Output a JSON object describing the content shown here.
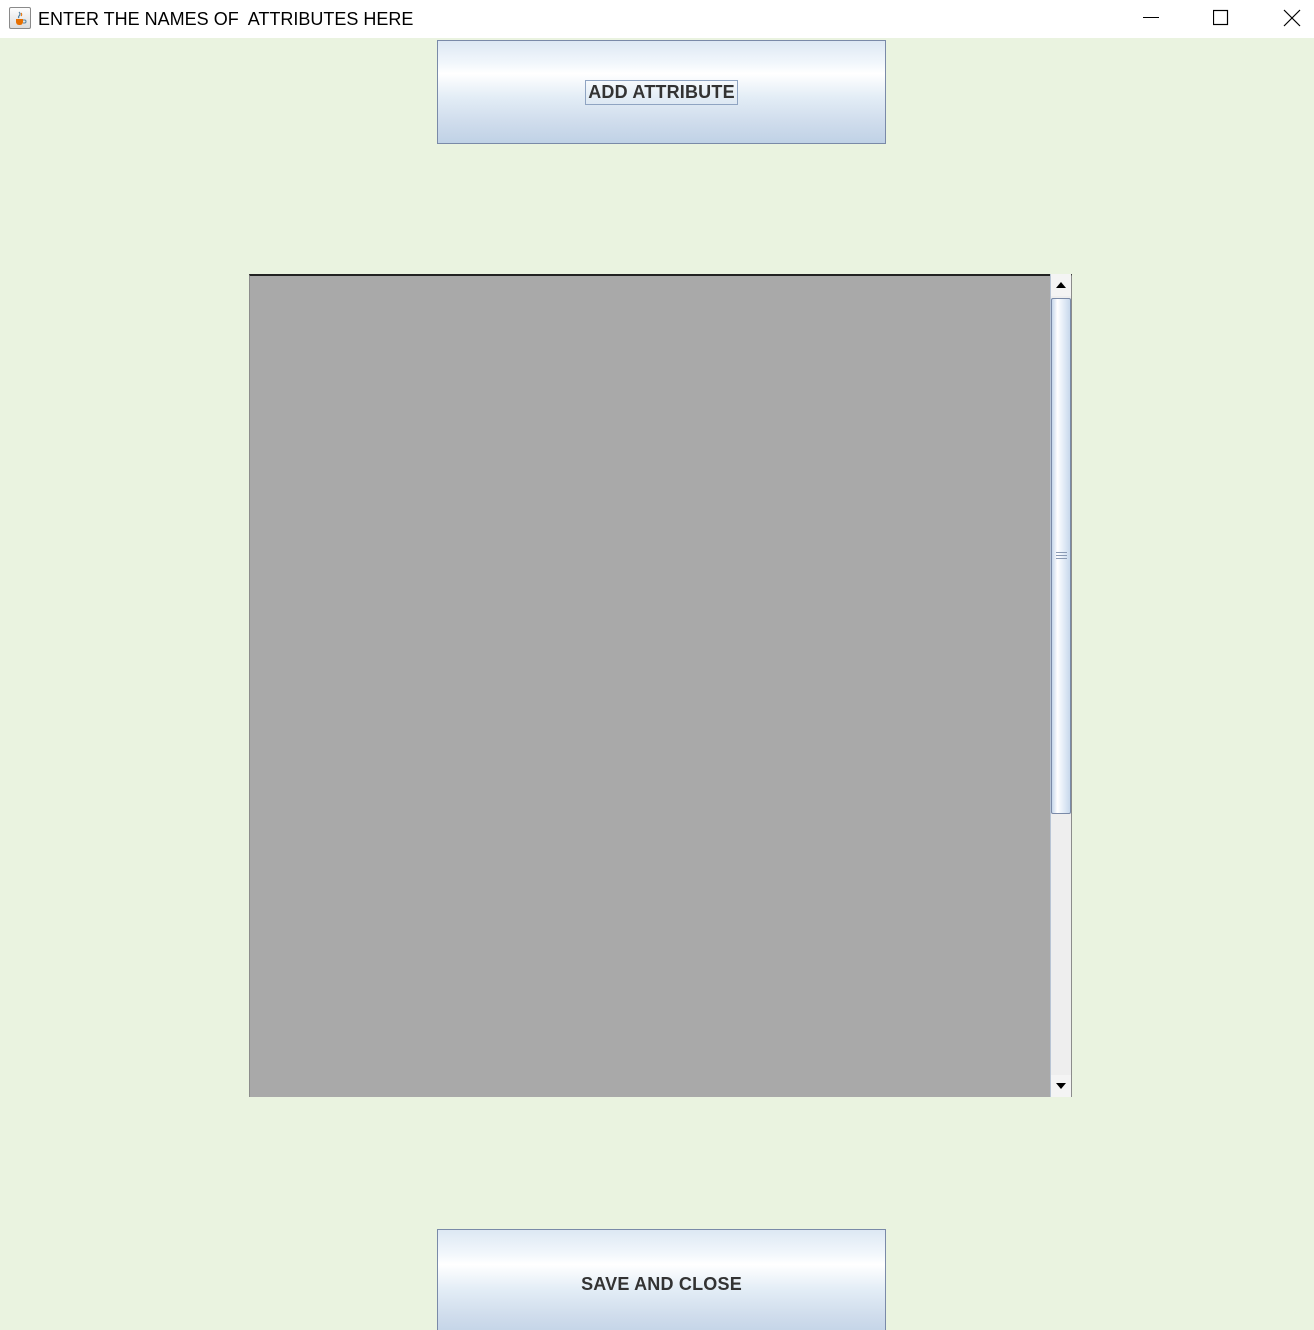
{
  "window": {
    "title": "ENTER THE NAMES OF  ATTRIBUTES HERE",
    "icon": "java-cup-icon",
    "controls": [
      "minimize-icon",
      "maximize-icon",
      "close-icon"
    ]
  },
  "buttons": {
    "add_attribute": "ADD ATTRIBUTE",
    "save_and_close": "SAVE AND CLOSE"
  },
  "attributes_panel": {
    "items": []
  },
  "colors": {
    "background": "#eaf3e0",
    "panel": "#a9a9a9",
    "button_text": "#333333"
  }
}
